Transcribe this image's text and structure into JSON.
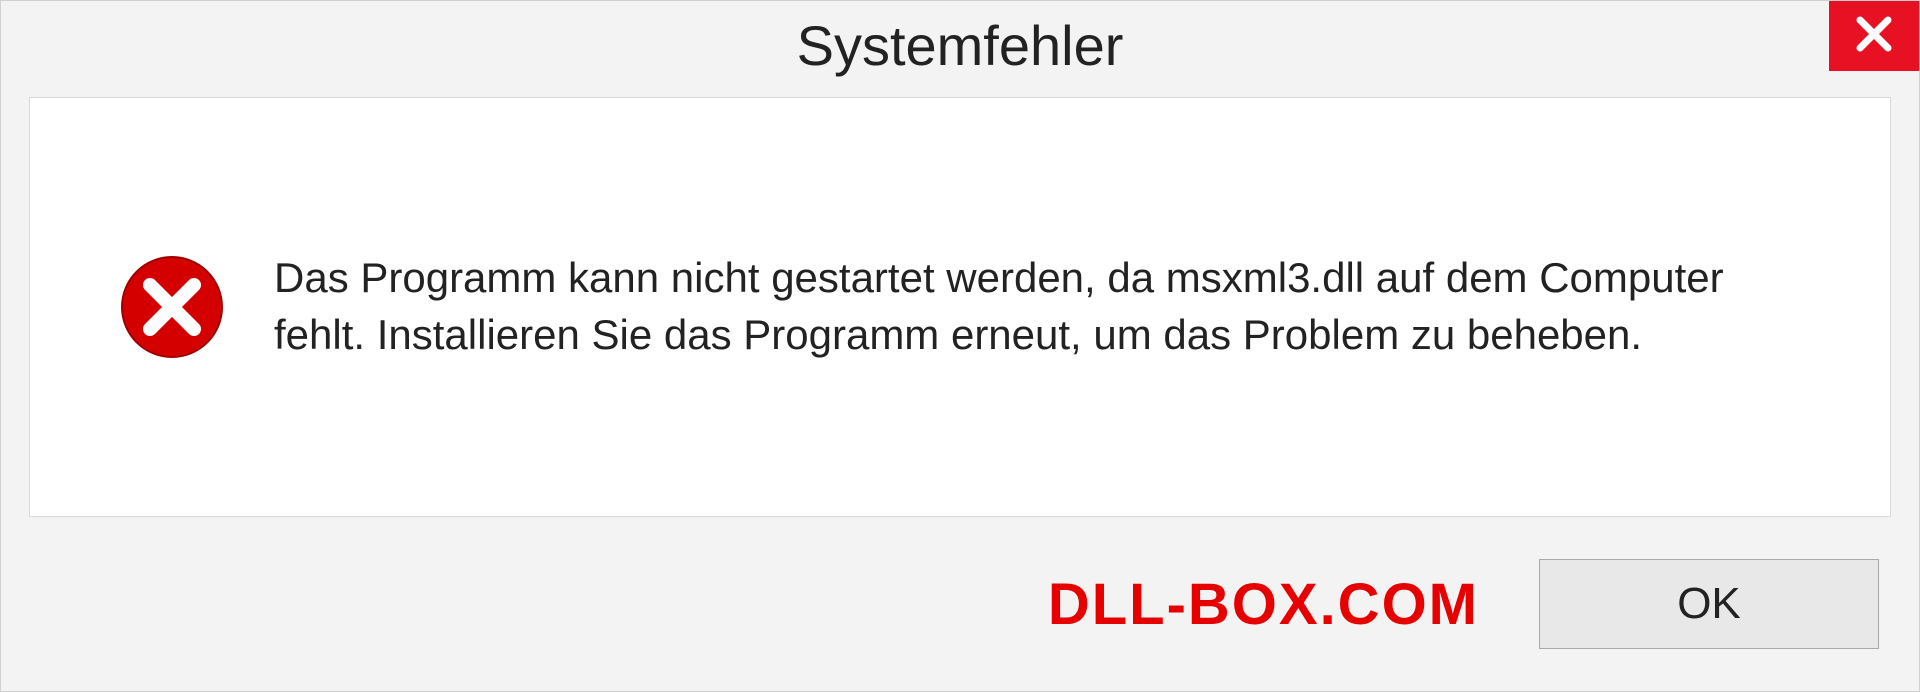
{
  "dialog": {
    "title": "Systemfehler",
    "message": "Das Programm kann nicht gestartet werden, da msxml3.dll auf dem Computer fehlt. Installieren Sie das Programm erneut, um das Problem zu beheben.",
    "watermark": "DLL-BOX.COM",
    "ok_label": "OK"
  },
  "colors": {
    "close_bg": "#e81123",
    "error_red": "#d40000",
    "watermark_red": "#e60000"
  }
}
